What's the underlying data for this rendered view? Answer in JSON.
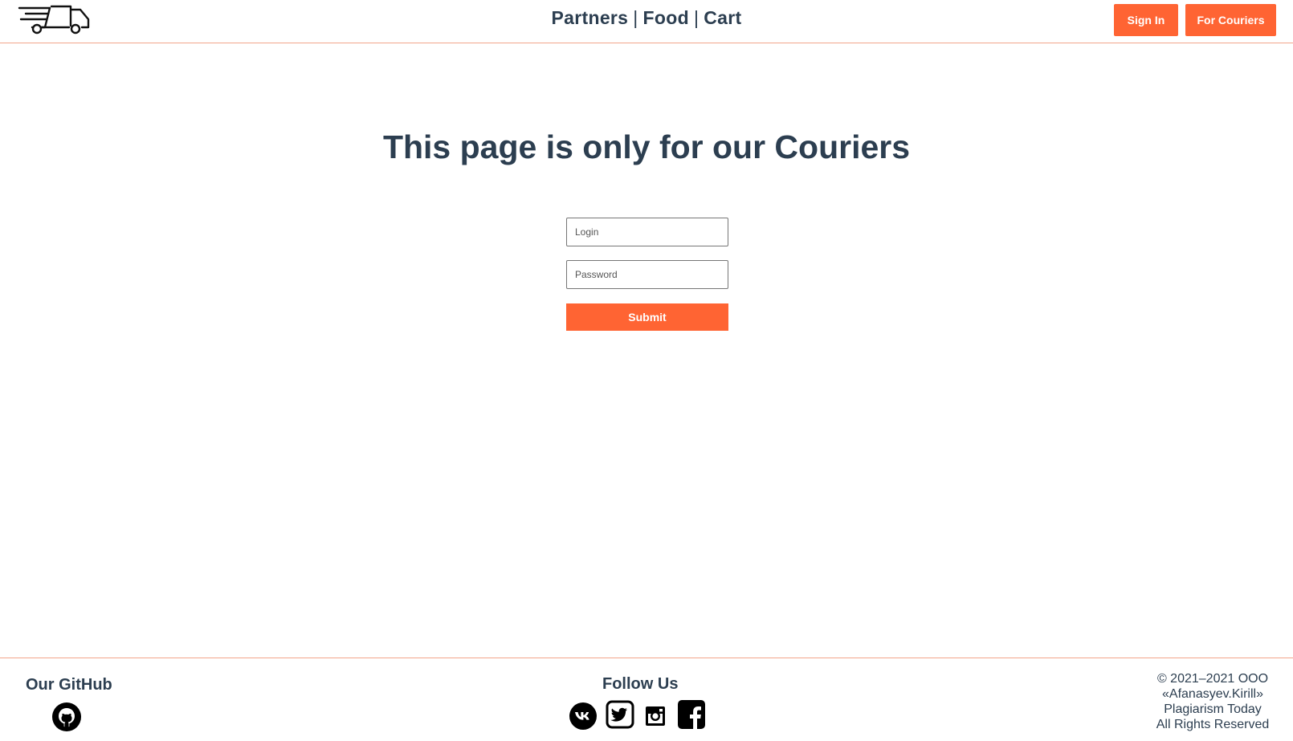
{
  "header": {
    "nav": [
      {
        "label": "Partners"
      },
      {
        "label": "Food"
      },
      {
        "label": "Cart"
      }
    ],
    "separator": "|",
    "sign_in_label": "Sign In",
    "for_couriers_label": "For Couriers",
    "logo_icon": "delivery-truck-icon"
  },
  "main": {
    "title": "This page is only for our Couriers",
    "login_placeholder": "Login",
    "password_placeholder": "Password",
    "submit_label": "Submit"
  },
  "footer": {
    "github_title": "Our GitHub",
    "github_icon": "github-icon",
    "follow_title": "Follow Us",
    "social_icons": [
      "vk-icon",
      "twitter-icon",
      "instagram-icon",
      "facebook-icon"
    ],
    "copyright": {
      "line1": "© 2021–2021 OOO",
      "line2": "«Afanasyev.Kirill»",
      "line3": "Plagiarism Today",
      "line4": "All Rights Reserved"
    }
  },
  "colors": {
    "accent": "#ff6433",
    "text": "#2c3e50",
    "divider": "#f3a58b"
  }
}
